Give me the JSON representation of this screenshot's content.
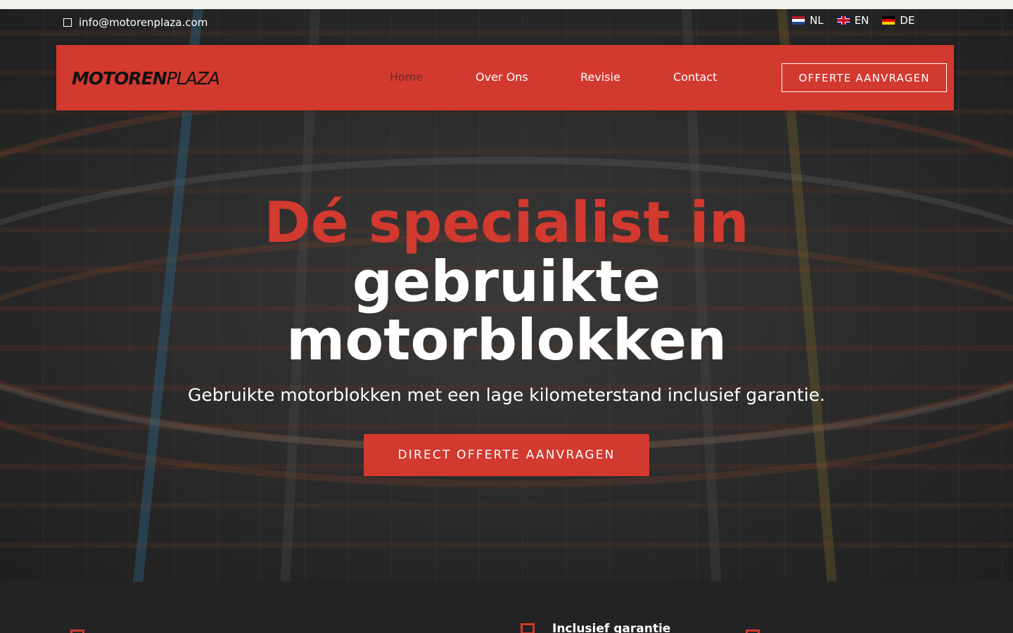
{
  "topbar": {
    "email": "info@motorenplaza.com",
    "email_icon": "mail-icon",
    "languages": [
      {
        "code": "NL",
        "flag": "netherlands-flag-icon"
      },
      {
        "code": "EN",
        "flag": "uk-flag-icon"
      },
      {
        "code": "DE",
        "flag": "germany-flag-icon"
      }
    ]
  },
  "navbar": {
    "logo_bold": "MOTOREN",
    "logo_light": "PLAZA",
    "items": [
      {
        "label": "Home",
        "active": true
      },
      {
        "label": "Over Ons",
        "active": false
      },
      {
        "label": "Revisie",
        "active": false
      },
      {
        "label": "Contact",
        "active": false
      }
    ],
    "cta_label": "OFFERTE AANVRAGEN"
  },
  "hero": {
    "headline_red": "Dé specialist in",
    "headline_line2": "gebruikte",
    "headline_line3": "motorblokken",
    "subtitle": "Gebruikte motorblokken met een lage kilometerstand inclusief garantie.",
    "cta_label": "DIRECT OFFERTE AANVRAGEN"
  },
  "features": {
    "visible_item": "Inclusief garantie"
  },
  "colors": {
    "accent": "#d2392f",
    "dark": "#232323"
  }
}
